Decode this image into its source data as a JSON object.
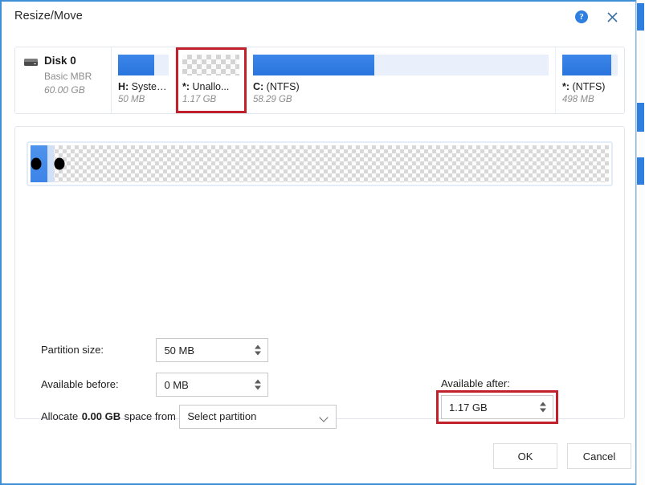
{
  "window": {
    "title": "Resize/Move",
    "help_icon": "help-circle-icon",
    "close_icon": "close-icon",
    "accent_color": "#2f7fe0",
    "highlight_color": "#c2202a"
  },
  "disk": {
    "name": "Disk 0",
    "type": "Basic MBR",
    "size": "60.00 GB",
    "icon": "hard-disk-icon",
    "partitions": [
      {
        "label": "H:",
        "fs": "System...",
        "size": "50 MB",
        "kind": "used",
        "used_pct": 72,
        "highlighted": false
      },
      {
        "label": "*:",
        "fs": "Unallo...",
        "size": "1.17 GB",
        "kind": "unalloc",
        "used_pct": 0,
        "highlighted": true
      },
      {
        "label": "C:",
        "fs": "(NTFS)",
        "size": "58.29 GB",
        "kind": "used",
        "used_pct": 41,
        "highlighted": false
      },
      {
        "label": "*:",
        "fs": "(NTFS)",
        "size": "498 MB",
        "kind": "used",
        "used_pct": 88,
        "highlighted": false
      }
    ]
  },
  "slider": {
    "left_handle": "left-resize-handle",
    "right_handle": "right-resize-handle",
    "block_pct": 4
  },
  "form": {
    "partition_size_label": "Partition size:",
    "partition_size_value": "50 MB",
    "available_before_label": "Available before:",
    "available_before_value": "0 MB",
    "available_after_label": "Available after:",
    "available_after_value": "1.17 GB",
    "allocate_prefix": "Allocate",
    "allocate_value": "0.00 GB",
    "allocate_suffix": "space from",
    "select_partition_value": "Select partition"
  },
  "footer": {
    "ok_label": "OK",
    "cancel_label": "Cancel"
  }
}
